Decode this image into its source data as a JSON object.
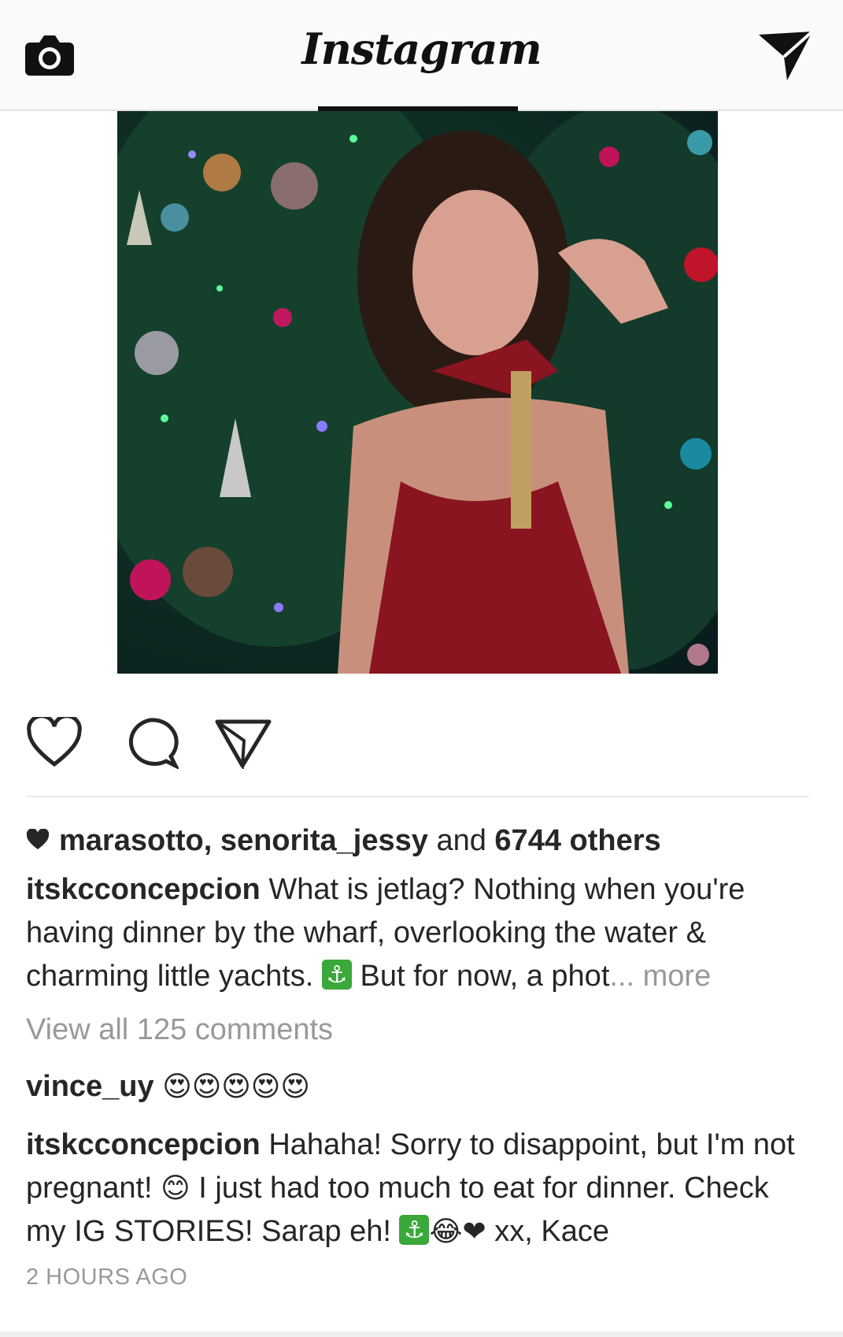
{
  "header": {
    "logo_text": "Instagram",
    "camera_icon": "camera-icon",
    "direct_icon": "paper-plane-icon"
  },
  "post": {
    "image_icon": "post-photo",
    "actions": {
      "like_icon": "heart-outline-icon",
      "comment_icon": "comment-bubble-icon",
      "share_icon": "send-icon"
    },
    "likes": {
      "users_text": "marasotto, senorita_jessy",
      "and_text": "and",
      "others_text": "6744 others"
    },
    "caption": {
      "username": "itskcconcepcion",
      "text_part1": "What is jetlag? Nothing when you're having dinner by the wharf, overlooking the water & charming little yachts.",
      "anchor_emoji": "⚓",
      "text_part2": "But for now, a phot",
      "ellipsis": "...",
      "more_label": "more"
    },
    "view_all_comments": "View all 125 comments",
    "comments": [
      {
        "username": "vince_uy",
        "emojis": "😍😍😍😍😍"
      },
      {
        "username": "itskcconcepcion",
        "text_part1": "Hahaha! Sorry to disappoint, but I'm not pregnant!",
        "emoji1": "😊",
        "text_part2": "I just had too much to eat for dinner. Check my IG STORIES! Sarap eh!",
        "anchor_emoji": "⚓",
        "emoji2": "😂❤",
        "text_part3": "xx, Kace"
      }
    ],
    "time_ago": "2 HOURS AGO"
  }
}
